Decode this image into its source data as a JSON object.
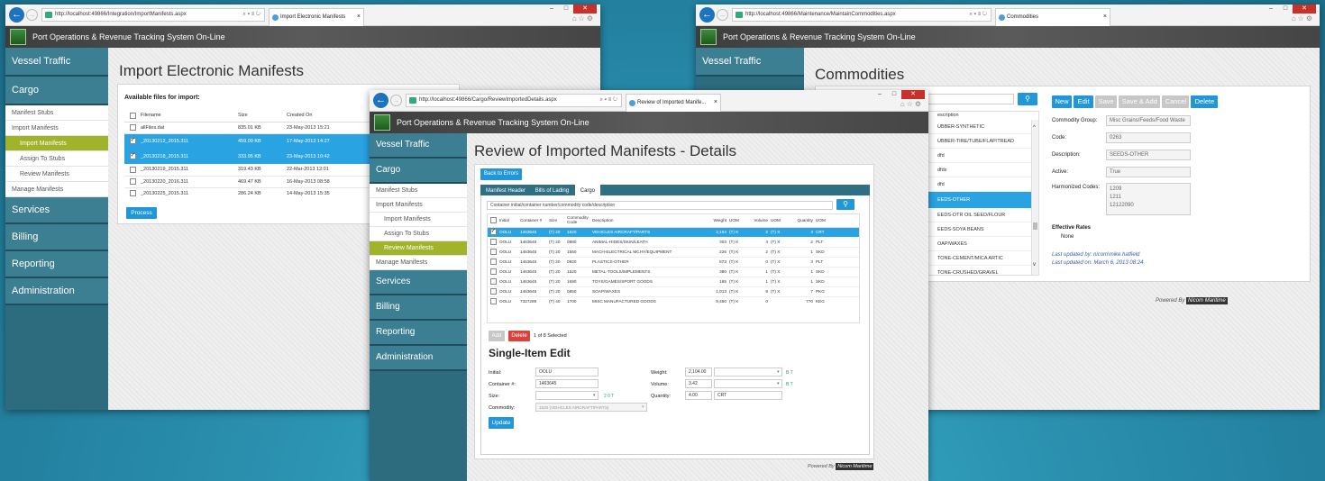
{
  "common": {
    "app_title": "Port Operations & Revenue Tracking System On-Line",
    "powered_by": "Powered By",
    "brand": "Nicom Maritime",
    "search_icon": "search-icon"
  },
  "win1": {
    "url": "http://localhost:49866/Integration/ImportManifests.aspx",
    "tab_title": "Import Electronic Manifests",
    "nav": {
      "vessel": "Vessel Traffic",
      "cargo": "Cargo",
      "manifest_stubs": "Manifest Stubs",
      "import_manifests": "Import Manifests",
      "import_manifests_sub": "Import Manifests",
      "assign_stubs": "Assign To Stubs",
      "review": "Review Manifests",
      "manage": "Manage Manifests",
      "services": "Services",
      "billing": "Billing",
      "reporting": "Reporting",
      "administration": "Administration"
    },
    "title": "Import Electronic Manifests",
    "panel_heading": "Available files for import:",
    "columns": [
      "Filename",
      "Size",
      "Created On"
    ],
    "rows": [
      {
        "name": "allFiles.dat",
        "size": "835.01 KB",
        "date": "23-May-2013 15:21"
      },
      {
        "name": "_20130212_2015.311",
        "size": "459.09 KB",
        "date": "17-May-2013 14:27"
      },
      {
        "name": "_20130218_2015.311",
        "size": "333.95 KB",
        "date": "23-May-2013 10:42"
      },
      {
        "name": "_20130219_2015.311",
        "size": "319.43 KB",
        "date": "22-Mar-2013 12:01"
      },
      {
        "name": "_20130220_2016.311",
        "size": "469.47 KB",
        "date": "16-May-2013 08:58"
      },
      {
        "name": "_20130225_2015.311",
        "size": "286.24 KB",
        "date": "14-May-2013 15:35"
      }
    ],
    "process": "Process"
  },
  "win2": {
    "url": "http://localhost:49866/Maintenance/MaintainCommodities.aspx",
    "tab_title": "Commodities",
    "nav": {
      "vessel": "Vessel Traffic"
    },
    "title": "Commodities",
    "buttons": {
      "new": "New",
      "edit": "Edit",
      "save": "Save",
      "save_add": "Save & Add",
      "cancel": "Cancel",
      "delete": "Delete"
    },
    "list_header": "escription",
    "list": [
      "UBBER-SYNTHETIC",
      "UBBER-TIRE/TUBE/FLAP/TREAD",
      "dfd",
      "dfds",
      "dfd",
      "EEDS-OTHER",
      "EEDS-OTR OIL SEED/FLOUR",
      "EEDS-SOYA BEANS",
      "OAP/WAXES",
      "TONE-CEMENT/MICA ARTIC",
      "TONE-CRUSHED/GRAVEL"
    ],
    "labels": {
      "group": "Commodity Group:",
      "code": "Code:",
      "description": "Description:",
      "active": "Active:",
      "harmonized": "Harmonized Codes:",
      "effective": "Effective Rates",
      "none": "None"
    },
    "values": {
      "group": "Misc Grains/Feeds/Food Waste",
      "code": "0263",
      "description": "SEEDS-OTHER",
      "active": "True",
      "harmonized": [
        "1209",
        "1211",
        "12122090"
      ]
    },
    "last_by": "Last updated by: nicom\\mike.hatfield",
    "last_on": "Last updated on: March 6, 2013 08:24"
  },
  "win3": {
    "url": "http://localhost:49866/Cargo/ReviewImportedDetails.aspx",
    "tab_title": "Review of Imported Manife...",
    "nav": {
      "vessel": "Vessel Traffic",
      "cargo": "Cargo",
      "manifest_stubs": "Manifest Stubs",
      "import_manifests": "Import Manifests",
      "import_manifests_sub": "Import Manifests",
      "assign_stubs": "Assign To Stubs",
      "review": "Review Manifests",
      "manage": "Manage Manifests",
      "services": "Services",
      "billing": "Billing",
      "reporting": "Reporting",
      "administration": "Administration"
    },
    "title": "Review of Imported Manifests - Details",
    "back": "Back to Errors",
    "tabs": [
      "Manifest Header",
      "Bills of Lading",
      "Cargo"
    ],
    "filter_placeholder": "Container initial/container number/commodity code/description",
    "columns": [
      "Initial",
      "Container #",
      "Size",
      "Commodity Code",
      "Description",
      "Weight",
      "UOM",
      "Volume",
      "UOM",
      "Quantity",
      "UOM"
    ],
    "rows": [
      [
        "OOLU",
        "1463645",
        "(T) 20",
        "1620",
        "VEHICLES AIRCRAFT/PARTS",
        "2,104",
        "(T) K",
        "2",
        "(T) X",
        "4",
        "CRT"
      ],
      [
        "OOLU",
        "1463645",
        "(T) 20",
        "0980",
        "ANIMAL-HIDES/SKIN/LEATH",
        "303",
        "(T) K",
        "4",
        "(T) X",
        "2",
        "PLT"
      ],
      [
        "OOLU",
        "1463645",
        "(T) 20",
        "1550",
        "MACH-ELECTRICAL MCHY/EQUIPMENT",
        "226",
        "(T) K",
        "2",
        "(T) X",
        "1",
        "SKD"
      ],
      [
        "OOLU",
        "1463645",
        "(T) 20",
        "0920",
        "PLASTICS-OTHER",
        "873",
        "(T) K",
        "0",
        "(T) X",
        "3",
        "PLT"
      ],
      [
        "OOLU",
        "1463645",
        "(T) 20",
        "1520",
        "METAL-TOOLS/IMPLEMENTS",
        "380",
        "(T) K",
        "1",
        "(T) X",
        "1",
        "SKD"
      ],
      [
        "OOLU",
        "1463645",
        "(T) 20",
        "1690",
        "TOYS/GAMES/SPORT GOODS",
        "185",
        "(T) K",
        "1",
        "(T) X",
        "1",
        "SKD"
      ],
      [
        "OOLU",
        "1463645",
        "(T) 20",
        "0850",
        "SOAP/WAXES",
        "1,013",
        "(T) K",
        "9",
        "(T) X",
        "7",
        "PKG"
      ],
      [
        "OOLU",
        "7327289",
        "(T) 40",
        "1700",
        "MISC MANUFACTURED GOODS",
        "9,450",
        "(T) K",
        "0",
        "",
        "770",
        "KEG"
      ]
    ],
    "add": "Add",
    "delete": "Delete",
    "selected": "1 of 8 Selected",
    "edit_title": "Single-Item Edit",
    "labels": {
      "initial": "Initial:",
      "container": "Container #:",
      "size": "Size:",
      "commodity": "Commodity:",
      "weight": "Weight:",
      "volume": "Volume:",
      "quantity": "Quantity:"
    },
    "values": {
      "initial": "OOLU",
      "container": "1463645",
      "size": "",
      "commodity": "1620 (VEHICLES AIRCRAFT/PARTS)",
      "weight": "2,104.00",
      "volume": "3.42",
      "quantity": "4.00",
      "quantity_uom": "CRT",
      "size_tag": "2 0 T",
      "weight_tag": "B T",
      "volume_tag": "B T"
    },
    "update": "Update"
  }
}
